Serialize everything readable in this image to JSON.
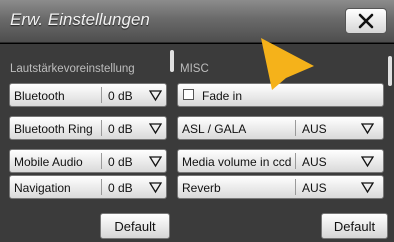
{
  "title": "Erw. Einstellungen",
  "close_icon": "close-x-icon",
  "left": {
    "section_label": "Lautstärkevoreinstellung",
    "items": [
      {
        "label": "Bluetooth",
        "value": "0 dB"
      },
      {
        "label": "Bluetooth Ring",
        "value": "0 dB"
      },
      {
        "label": "Mobile Audio",
        "value": "0 dB"
      },
      {
        "label": "Navigation",
        "value": "0 dB"
      }
    ],
    "default_label": "Default"
  },
  "right": {
    "section_label": "MISC",
    "fade_in": {
      "label": "Fade in",
      "checked": false
    },
    "items": [
      {
        "label": "ASL / GALA",
        "value": "AUS"
      },
      {
        "label": "Media volume in ccd",
        "value": "AUS"
      },
      {
        "label": "Reverb",
        "value": "AUS"
      }
    ],
    "default_label": "Default"
  },
  "colors": {
    "titlebar": "#6a6a6a",
    "background": "#3b3b3b",
    "pointer": "#f5b21a"
  }
}
